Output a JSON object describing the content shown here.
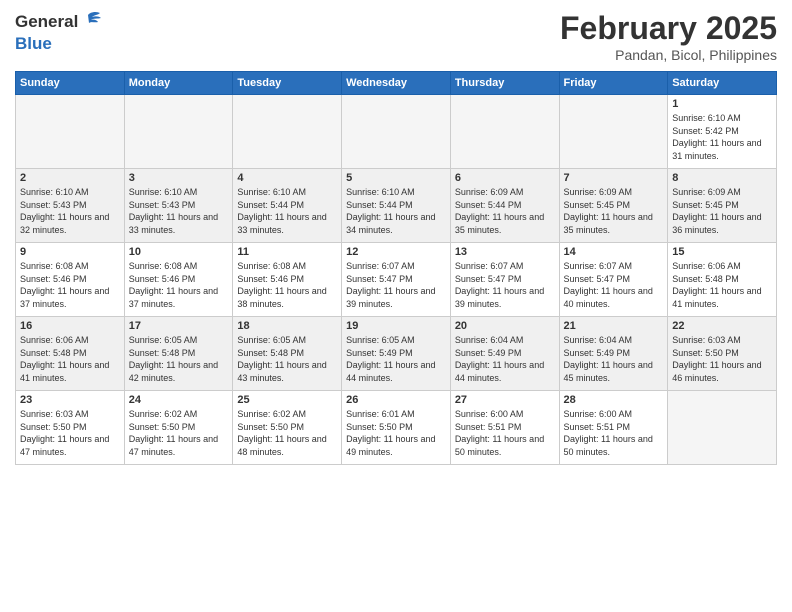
{
  "header": {
    "logo": {
      "general": "General",
      "blue": "Blue"
    },
    "title": "February 2025",
    "location": "Pandan, Bicol, Philippines"
  },
  "weekdays": [
    "Sunday",
    "Monday",
    "Tuesday",
    "Wednesday",
    "Thursday",
    "Friday",
    "Saturday"
  ],
  "weeks": [
    [
      {
        "day": "",
        "info": "",
        "empty": true
      },
      {
        "day": "",
        "info": "",
        "empty": true
      },
      {
        "day": "",
        "info": "",
        "empty": true
      },
      {
        "day": "",
        "info": "",
        "empty": true
      },
      {
        "day": "",
        "info": "",
        "empty": true
      },
      {
        "day": "",
        "info": "",
        "empty": true
      },
      {
        "day": "1",
        "info": "Sunrise: 6:10 AM\nSunset: 5:42 PM\nDaylight: 11 hours and 31 minutes."
      }
    ],
    [
      {
        "day": "2",
        "info": "Sunrise: 6:10 AM\nSunset: 5:43 PM\nDaylight: 11 hours and 32 minutes."
      },
      {
        "day": "3",
        "info": "Sunrise: 6:10 AM\nSunset: 5:43 PM\nDaylight: 11 hours and 33 minutes."
      },
      {
        "day": "4",
        "info": "Sunrise: 6:10 AM\nSunset: 5:44 PM\nDaylight: 11 hours and 33 minutes."
      },
      {
        "day": "5",
        "info": "Sunrise: 6:10 AM\nSunset: 5:44 PM\nDaylight: 11 hours and 34 minutes."
      },
      {
        "day": "6",
        "info": "Sunrise: 6:09 AM\nSunset: 5:44 PM\nDaylight: 11 hours and 35 minutes."
      },
      {
        "day": "7",
        "info": "Sunrise: 6:09 AM\nSunset: 5:45 PM\nDaylight: 11 hours and 35 minutes."
      },
      {
        "day": "8",
        "info": "Sunrise: 6:09 AM\nSunset: 5:45 PM\nDaylight: 11 hours and 36 minutes."
      }
    ],
    [
      {
        "day": "9",
        "info": "Sunrise: 6:08 AM\nSunset: 5:46 PM\nDaylight: 11 hours and 37 minutes."
      },
      {
        "day": "10",
        "info": "Sunrise: 6:08 AM\nSunset: 5:46 PM\nDaylight: 11 hours and 37 minutes."
      },
      {
        "day": "11",
        "info": "Sunrise: 6:08 AM\nSunset: 5:46 PM\nDaylight: 11 hours and 38 minutes."
      },
      {
        "day": "12",
        "info": "Sunrise: 6:07 AM\nSunset: 5:47 PM\nDaylight: 11 hours and 39 minutes."
      },
      {
        "day": "13",
        "info": "Sunrise: 6:07 AM\nSunset: 5:47 PM\nDaylight: 11 hours and 39 minutes."
      },
      {
        "day": "14",
        "info": "Sunrise: 6:07 AM\nSunset: 5:47 PM\nDaylight: 11 hours and 40 minutes."
      },
      {
        "day": "15",
        "info": "Sunrise: 6:06 AM\nSunset: 5:48 PM\nDaylight: 11 hours and 41 minutes."
      }
    ],
    [
      {
        "day": "16",
        "info": "Sunrise: 6:06 AM\nSunset: 5:48 PM\nDaylight: 11 hours and 41 minutes."
      },
      {
        "day": "17",
        "info": "Sunrise: 6:05 AM\nSunset: 5:48 PM\nDaylight: 11 hours and 42 minutes."
      },
      {
        "day": "18",
        "info": "Sunrise: 6:05 AM\nSunset: 5:48 PM\nDaylight: 11 hours and 43 minutes."
      },
      {
        "day": "19",
        "info": "Sunrise: 6:05 AM\nSunset: 5:49 PM\nDaylight: 11 hours and 44 minutes."
      },
      {
        "day": "20",
        "info": "Sunrise: 6:04 AM\nSunset: 5:49 PM\nDaylight: 11 hours and 44 minutes."
      },
      {
        "day": "21",
        "info": "Sunrise: 6:04 AM\nSunset: 5:49 PM\nDaylight: 11 hours and 45 minutes."
      },
      {
        "day": "22",
        "info": "Sunrise: 6:03 AM\nSunset: 5:50 PM\nDaylight: 11 hours and 46 minutes."
      }
    ],
    [
      {
        "day": "23",
        "info": "Sunrise: 6:03 AM\nSunset: 5:50 PM\nDaylight: 11 hours and 47 minutes."
      },
      {
        "day": "24",
        "info": "Sunrise: 6:02 AM\nSunset: 5:50 PM\nDaylight: 11 hours and 47 minutes."
      },
      {
        "day": "25",
        "info": "Sunrise: 6:02 AM\nSunset: 5:50 PM\nDaylight: 11 hours and 48 minutes."
      },
      {
        "day": "26",
        "info": "Sunrise: 6:01 AM\nSunset: 5:50 PM\nDaylight: 11 hours and 49 minutes."
      },
      {
        "day": "27",
        "info": "Sunrise: 6:00 AM\nSunset: 5:51 PM\nDaylight: 11 hours and 50 minutes."
      },
      {
        "day": "28",
        "info": "Sunrise: 6:00 AM\nSunset: 5:51 PM\nDaylight: 11 hours and 50 minutes."
      },
      {
        "day": "",
        "info": "",
        "empty": true
      }
    ]
  ]
}
